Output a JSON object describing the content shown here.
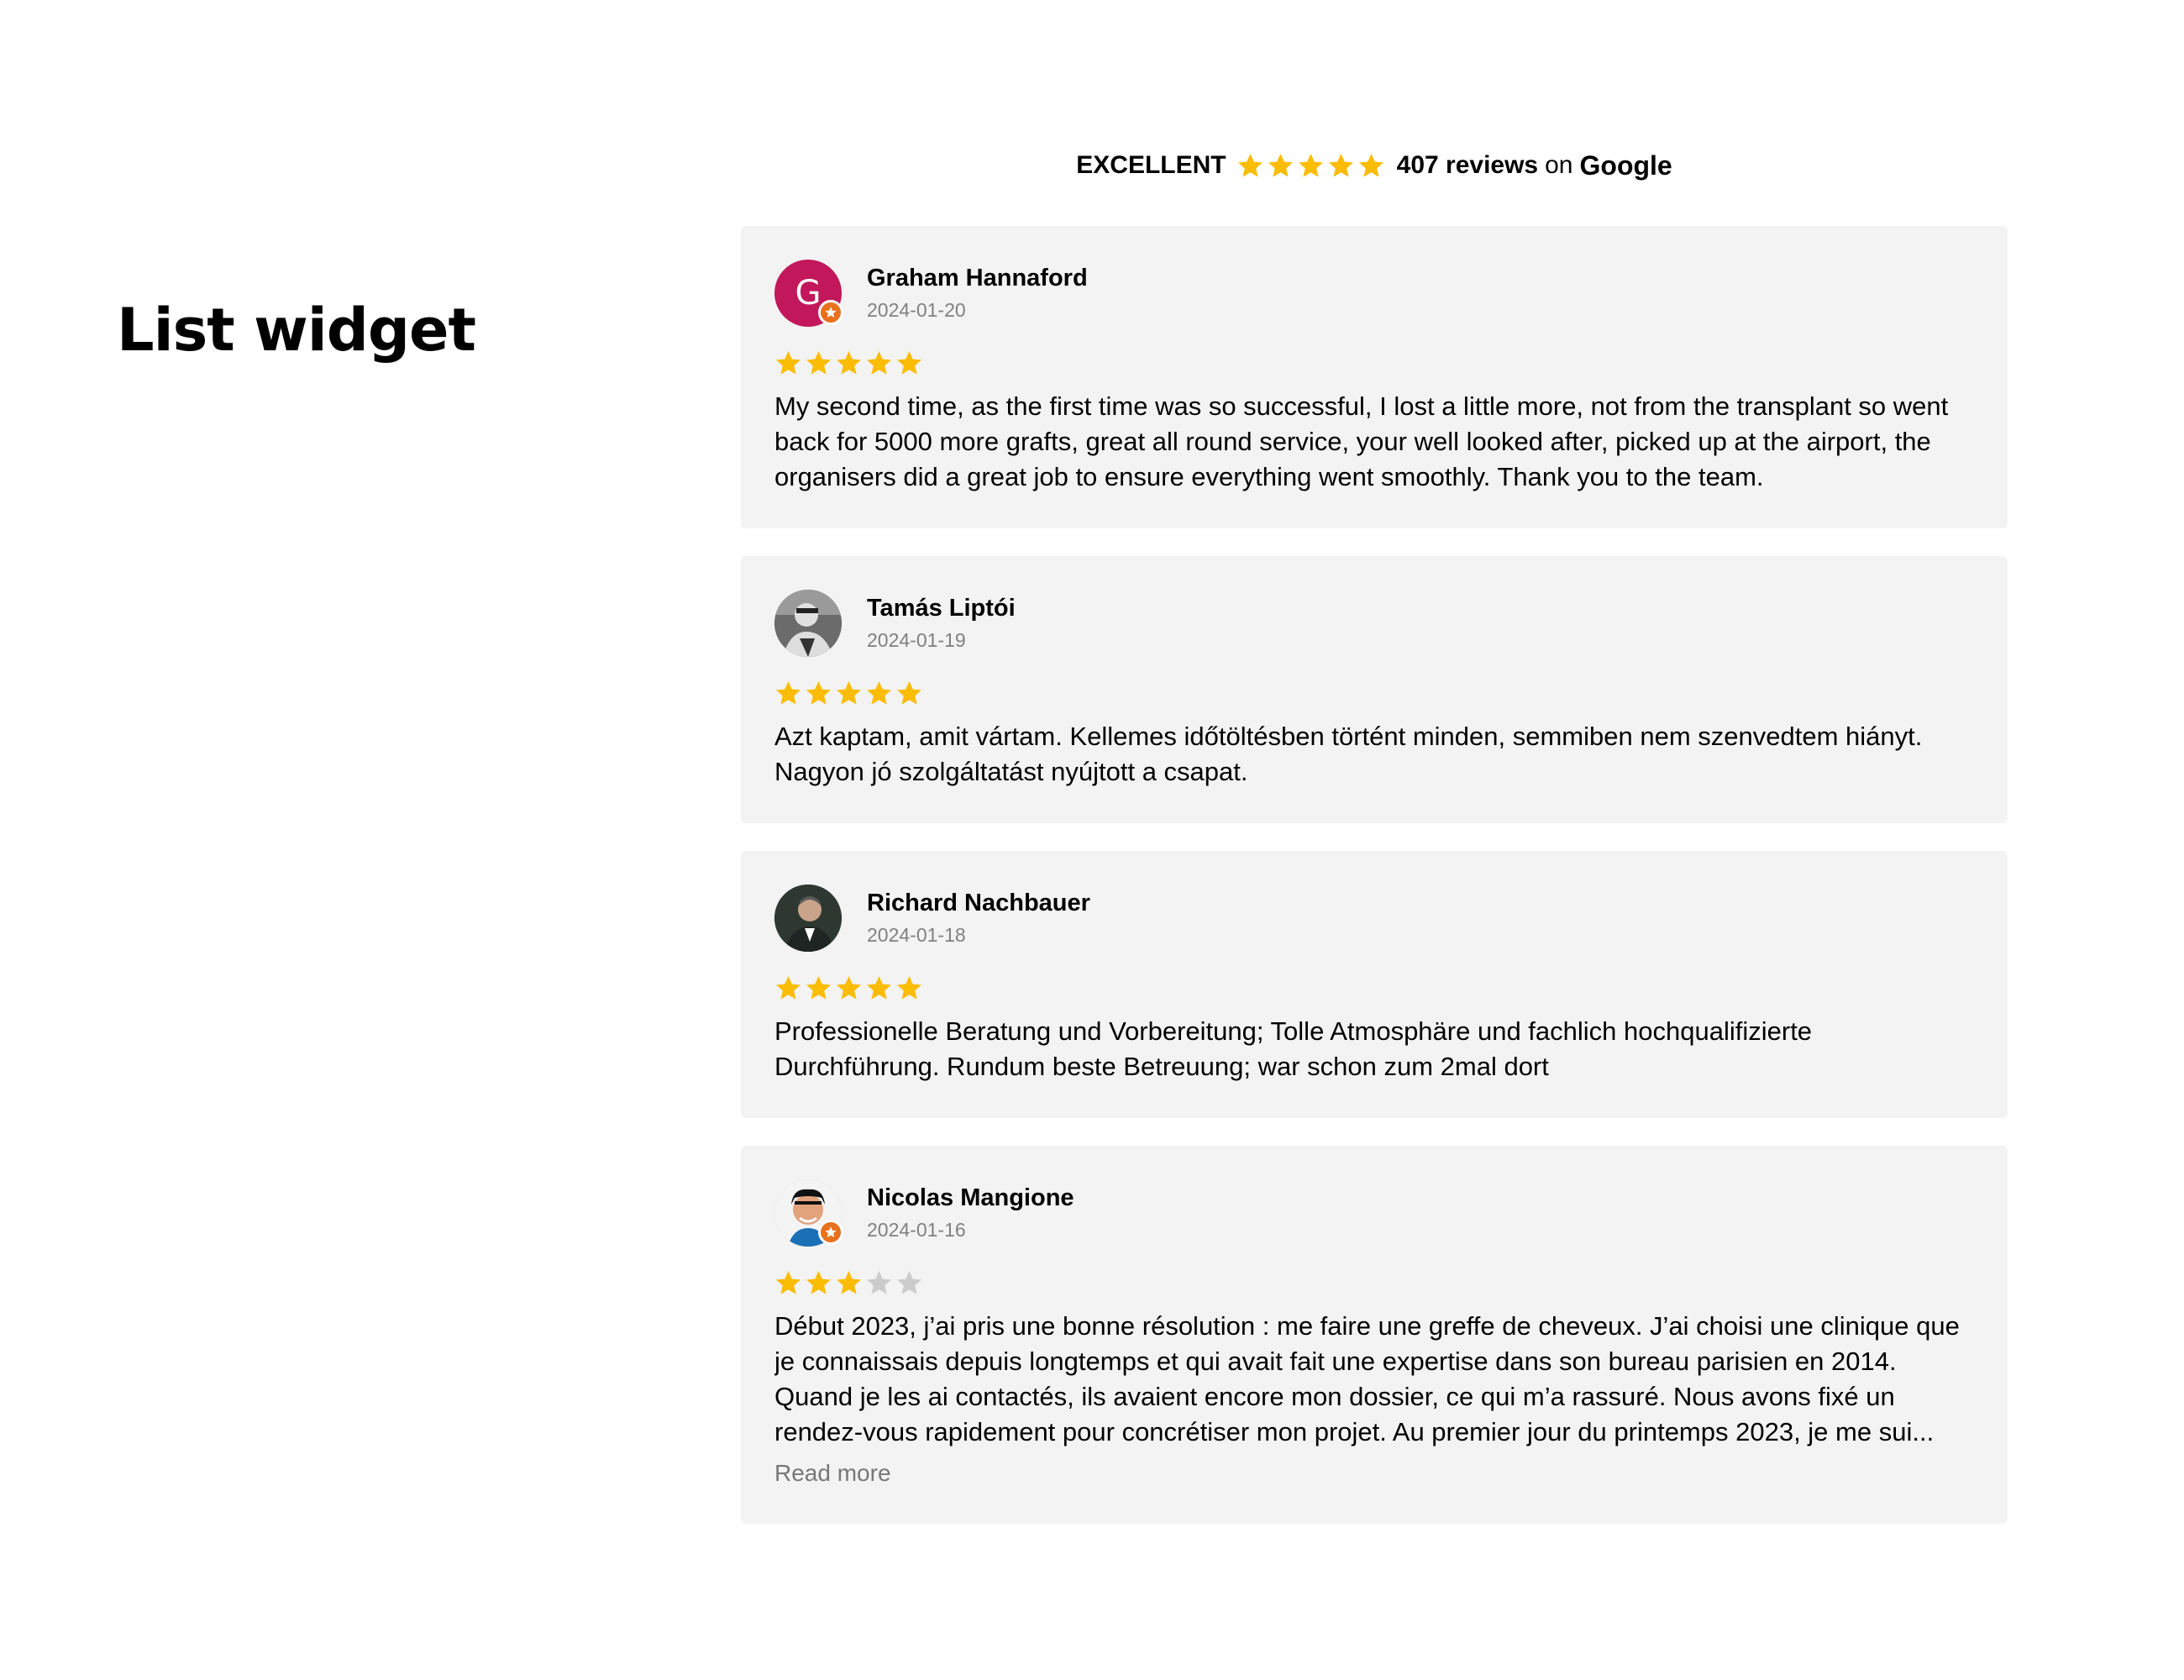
{
  "page": {
    "title": "List widget"
  },
  "summary": {
    "rating_word": "EXCELLENT",
    "rating": 5,
    "review_count": "407 reviews",
    "on_word": "on",
    "platform": "Google"
  },
  "colors": {
    "star_filled": "#fbbc04",
    "star_empty": "#cccccc",
    "card_background": "#f3f3f3",
    "badge": "#e8711e"
  },
  "reviews": [
    {
      "author": "Graham Hannaford",
      "date": "2024-01-20",
      "rating": 5,
      "avatar_letter": "G",
      "avatar_color": "#c2185b",
      "local_guide_badge": true,
      "text": "My second time, as the first time was so successful, I lost a little more, not from the transplant so went back for 5000 more grafts, great all round service, your well looked after, picked up at the airport, the organisers did a great job to ensure everything went smoothly. Thank you to the team."
    },
    {
      "author": "Tamás Liptói",
      "date": "2024-01-19",
      "rating": 5,
      "avatar_letter": "",
      "avatar_color": "#555555",
      "local_guide_badge": false,
      "text": "Azt kaptam, amit vártam. Kellemes időtöltésben történt minden, semmiben nem szenvedtem hiányt. Nagyon jó szolgáltatást nyújtott a csapat."
    },
    {
      "author": "Richard Nachbauer",
      "date": "2024-01-18",
      "rating": 5,
      "avatar_letter": "",
      "avatar_color": "#2f3a33",
      "local_guide_badge": false,
      "text": "Professionelle Beratung und Vorbereitung; Tolle Atmosphäre und fachlich hochqualifizierte Durchführung. Rundum beste Betreuung; war schon zum 2mal dort"
    },
    {
      "author": "Nicolas Mangione",
      "date": "2024-01-16",
      "rating": 3,
      "avatar_letter": "",
      "avatar_color": "#d9a98a",
      "local_guide_badge": true,
      "text": "Début 2023, j’ai pris une bonne résolution : me faire une greffe de cheveux. J’ai choisi une clinique que je connaissais depuis longtemps et qui avait fait une expertise dans son bureau parisien en 2014. Quand je les ai contactés, ils avaient encore mon dossier, ce qui m’a rassuré. Nous avons fixé un rendez-vous rapidement pour concrétiser mon projet. Au premier jour du printemps 2023, je me sui...",
      "read_more": "Read more"
    }
  ]
}
